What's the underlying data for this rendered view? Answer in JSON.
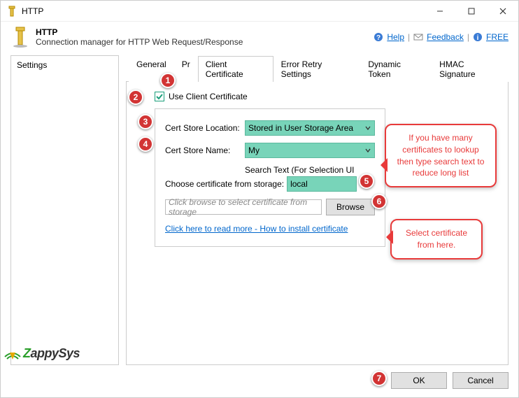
{
  "window": {
    "title": "HTTP"
  },
  "header": {
    "title": "HTTP",
    "subtitle": "Connection manager for HTTP Web Request/Response"
  },
  "help": {
    "help": "Help",
    "feedback": "Feedback",
    "free": "FREE"
  },
  "sidebar": {
    "items": [
      "Settings"
    ]
  },
  "tabs": {
    "items": [
      "General",
      "Pr",
      "Client Certificate",
      "Error Retry Settings",
      "Dynamic Token",
      "HMAC Signature"
    ],
    "active_index": 2
  },
  "form": {
    "use_client_cert_label": "Use Client Certificate",
    "use_client_cert_checked": true,
    "store_location_label": "Cert Store Location:",
    "store_location_value": "Stored in User Storage Area",
    "store_name_label": "Cert Store Name:",
    "store_name_value": "My",
    "search_label": "Search Text (For Selection UI",
    "search_value": "local",
    "choose_label": "Choose certificate from storage:",
    "choose_placeholder": "Click browse to select certificate from storage",
    "browse_label": "Browse",
    "readmore_label": "Click here to read more - How to install certificate"
  },
  "callouts": {
    "c1": "If you have many certificates to lookup then type search text to reduce long list",
    "c2": "Select certificate from here."
  },
  "markers": {
    "m1": "1",
    "m2": "2",
    "m3": "3",
    "m4": "4",
    "m5": "5",
    "m6": "6",
    "m7": "7"
  },
  "footer": {
    "ok": "OK",
    "cancel": "Cancel"
  },
  "logo": {
    "text1": "Z",
    "text2": "appySys"
  }
}
